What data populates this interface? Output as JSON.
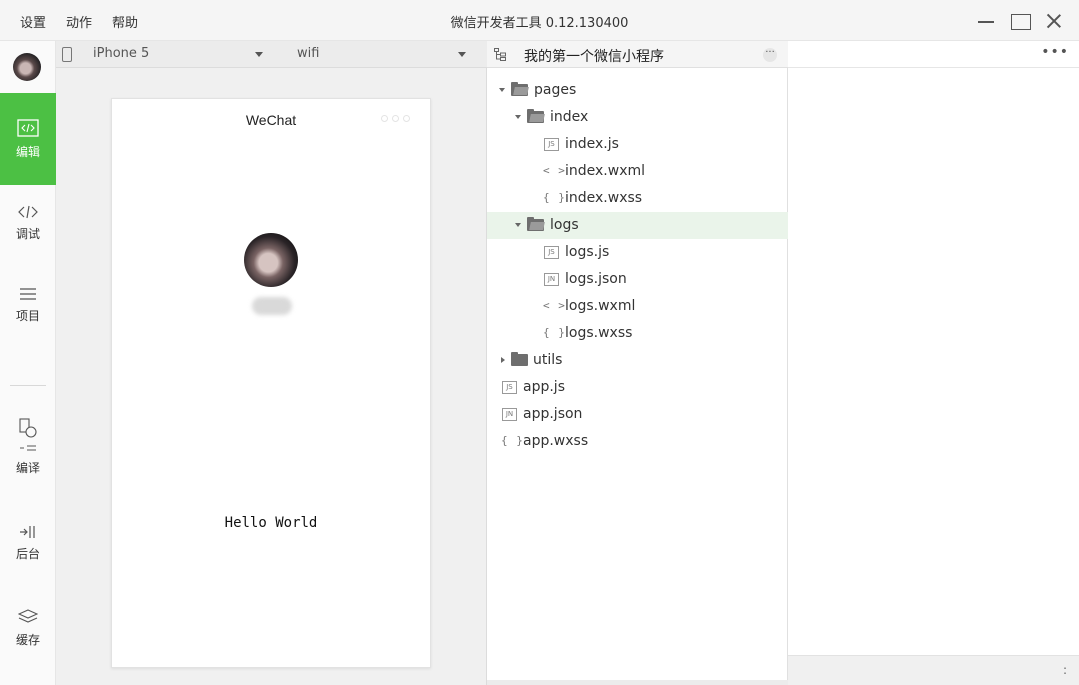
{
  "menu": [
    "设置",
    "动作",
    "帮助"
  ],
  "window_title": "微信开发者工具 0.12.130400",
  "sidebar": {
    "items": [
      {
        "label": "编辑",
        "icon": "code-icon",
        "active": true
      },
      {
        "label": "调试",
        "icon": "debug-icon",
        "active": false
      },
      {
        "label": "项目",
        "icon": "menu-lines-icon",
        "active": false
      },
      {
        "label": "编译",
        "icon": "compile-icon",
        "active": false
      },
      {
        "label": "后台",
        "icon": "background-icon",
        "active": false
      },
      {
        "label": "缓存",
        "icon": "layers-icon",
        "active": false
      }
    ]
  },
  "simulator": {
    "device": "iPhone 5",
    "network": "wifi",
    "nav_title": "WeChat",
    "hello_text": "Hello World"
  },
  "tree": {
    "project_name": "我的第一个微信小程序",
    "items": [
      {
        "name": "pages",
        "kind": "folder-open"
      },
      {
        "name": "index",
        "kind": "folder-open"
      },
      {
        "name": "index.js",
        "kind": "js",
        "badge": "JS"
      },
      {
        "name": "index.wxml",
        "kind": "wxml",
        "glyph": "< >"
      },
      {
        "name": "index.wxss",
        "kind": "wxss",
        "glyph": "{ }"
      },
      {
        "name": "logs",
        "kind": "folder-open",
        "selected": true
      },
      {
        "name": "logs.js",
        "kind": "js",
        "badge": "JS"
      },
      {
        "name": "logs.json",
        "kind": "json",
        "badge": "JN"
      },
      {
        "name": "logs.wxml",
        "kind": "wxml",
        "glyph": "< >"
      },
      {
        "name": "logs.wxss",
        "kind": "wxss",
        "glyph": "{ }"
      },
      {
        "name": "utils",
        "kind": "folder-closed"
      },
      {
        "name": "app.js",
        "kind": "js",
        "badge": "JS"
      },
      {
        "name": "app.json",
        "kind": "json",
        "badge": "JN"
      },
      {
        "name": "app.wxss",
        "kind": "wxss",
        "glyph": "{ }"
      }
    ]
  },
  "editor": {
    "more": "•••",
    "status_colon": ":"
  },
  "colors": {
    "accent_green": "#4cc044",
    "selected_row": "#eaf4ea"
  }
}
